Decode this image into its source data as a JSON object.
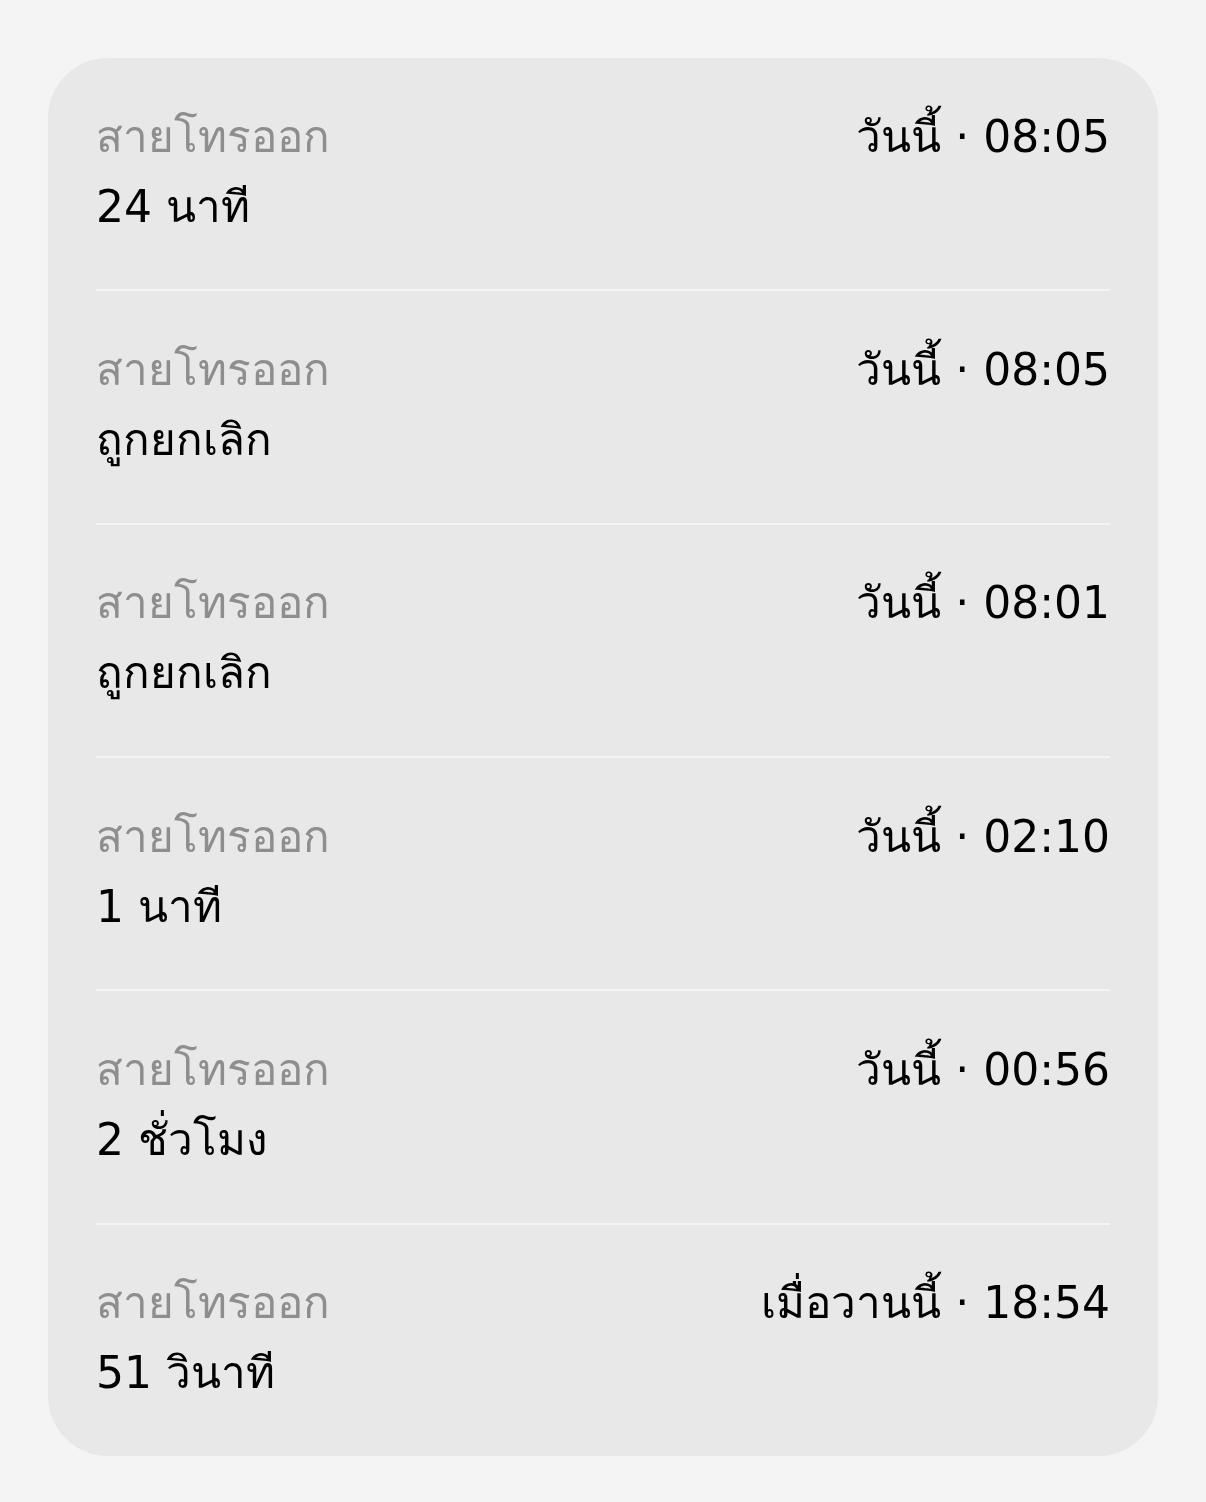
{
  "calls": [
    {
      "type": "สายโทรออก",
      "time": "วันนี้ · 08:05",
      "detail": "24 นาที"
    },
    {
      "type": "สายโทรออก",
      "time": "วันนี้ · 08:05",
      "detail": "ถูกยกเลิก"
    },
    {
      "type": "สายโทรออก",
      "time": "วันนี้ · 08:01",
      "detail": "ถูกยกเลิก"
    },
    {
      "type": "สายโทรออก",
      "time": "วันนี้ · 02:10",
      "detail": "1 นาที"
    },
    {
      "type": "สายโทรออก",
      "time": "วันนี้ · 00:56",
      "detail": "2 ชั่วโมง"
    },
    {
      "type": "สายโทรออก",
      "time": "เมื่อวานนี้ · 18:54",
      "detail": "51 วินาที"
    }
  ]
}
